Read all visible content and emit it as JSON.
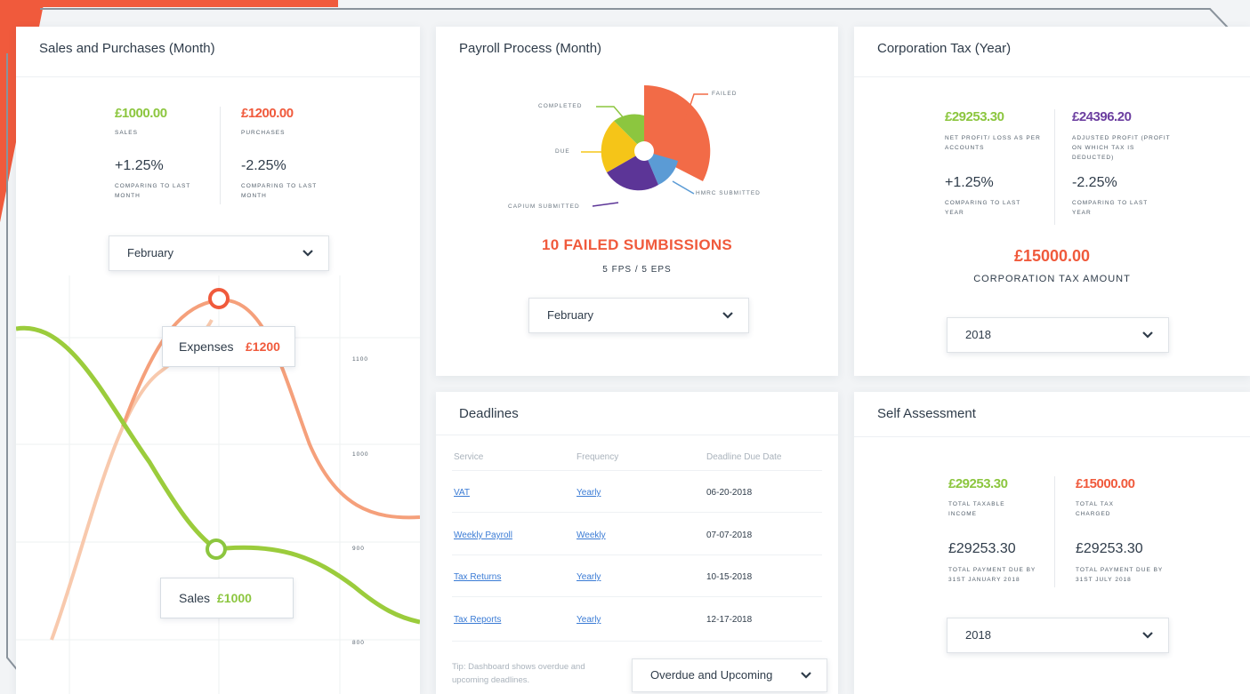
{
  "colors": {
    "green": "#8cc63f",
    "orange": "#f05a3c",
    "purple": "#6c3fa0",
    "blue": "#5b9bd5",
    "yellow": "#f5c518",
    "link": "#3a7bd5",
    "accent_frame": "#f05a3c"
  },
  "sales_purchases": {
    "title": "Sales and Purchases (Month)",
    "sales_value": "£1000.00",
    "sales_label": "SALES",
    "purchases_value": "£1200.00",
    "purchases_label": "PURCHASES",
    "sales_change": "+1.25%",
    "sales_change_label": "COMPARING TO LAST MONTH",
    "purchases_change": "-2.25%",
    "purchases_change_label": "COMPARING TO LAST MONTH",
    "month_select": "February",
    "expenses_tooltip_label": "Expenses",
    "expenses_tooltip_value": "£1200",
    "sales_tooltip_label": "Sales",
    "sales_tooltip_value": "£1000",
    "y_ticks": [
      "1100",
      "1000",
      "900",
      "800"
    ]
  },
  "payroll": {
    "title": "Payroll Process (Month)",
    "legend_completed": "COMPLETED",
    "legend_failed": "FAILED",
    "legend_due": "DUE",
    "legend_hmrc": "HMRC SUBMITTED",
    "legend_capium": "CAPIUM SUBMITTED",
    "headline": "10 FAILED SUMBISSIONS",
    "subline": "5 FPS / 5 EPS",
    "month_select": "February"
  },
  "corp_tax": {
    "title": "Corporation Tax (Year)",
    "net_profit_value": "£29253.30",
    "net_profit_label": "NET PROFIT/ LOSS AS PER ACCOUNTS",
    "adjusted_value": "£24396.20",
    "adjusted_label": "ADJUSTED PROFIT (PROFIT ON WHICH TAX IS DEDUCTED)",
    "net_change": "+1.25%",
    "net_change_label": "COMPARING TO LAST YEAR",
    "adjusted_change": "-2.25%",
    "adjusted_change_label": "COMPARING TO LAST YEAR",
    "tax_amount": "£15000.00",
    "tax_amount_label": "CORPORATION TAX AMOUNT",
    "year_select": "2018"
  },
  "deadlines": {
    "title": "Deadlines",
    "headers": [
      "Service",
      "Frequency",
      "Deadline Due Date"
    ],
    "rows": [
      {
        "service": "VAT",
        "frequency": "Yearly",
        "date": "06-20-2018"
      },
      {
        "service": "Weekly Payroll",
        "frequency": "Weekly",
        "date": "07-07-2018"
      },
      {
        "service": "Tax Returns",
        "frequency": "Yearly",
        "date": "10-15-2018"
      },
      {
        "service": "Tax Reports",
        "frequency": "Yearly",
        "date": "12-17-2018"
      }
    ],
    "tip": "Tip: Dashboard shows overdue and upcoming deadlines.",
    "filter_select": "Overdue and Upcoming"
  },
  "self_assessment": {
    "title": "Self Assessment",
    "taxable_value": "£29253.30",
    "taxable_label": "TOTAL TAXABLE INCOME",
    "charged_value": "£15000.00",
    "charged_label": "TOTAL TAX CHARGED",
    "due_jan_value": "£29253.30",
    "due_jan_label": "TOTAL PAYMENT DUE BY 31ST JANUARY 2018",
    "due_jul_value": "£29253.30",
    "due_jul_label": "TOTAL PAYMENT DUE BY 31ST JULY 2018",
    "year_select": "2018"
  }
}
